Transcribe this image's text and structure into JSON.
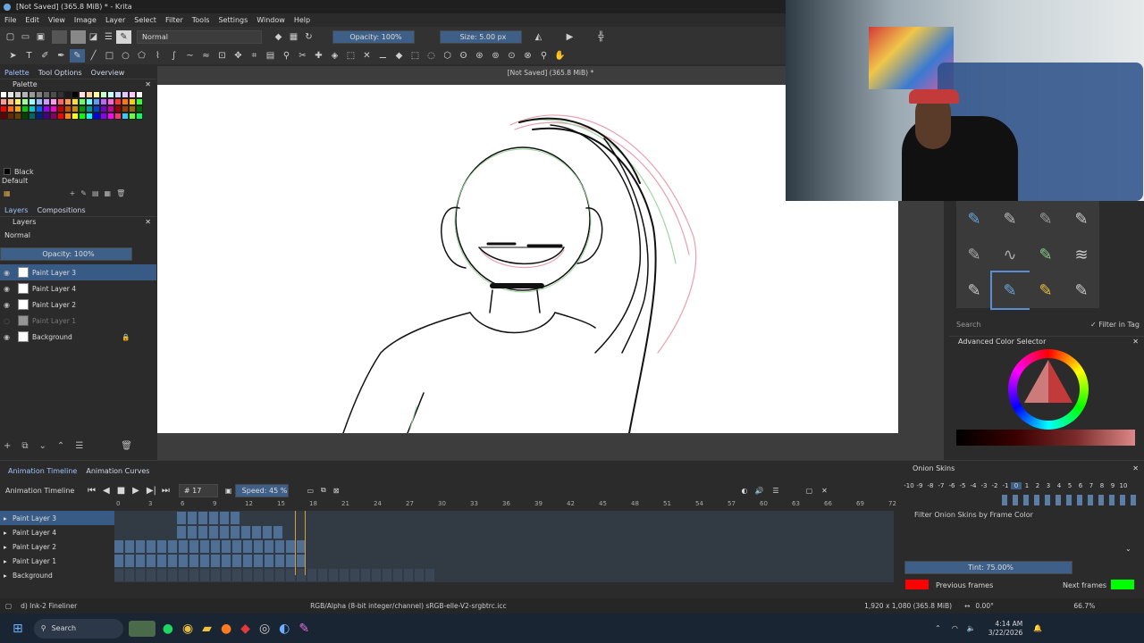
{
  "window": {
    "title": "[Not Saved]  (365.8 MiB) * - Krita"
  },
  "menu": [
    "File",
    "Edit",
    "View",
    "Image",
    "Layer",
    "Select",
    "Filter",
    "Tools",
    "Settings",
    "Window",
    "Help"
  ],
  "toolbar": {
    "blend_mode": "Normal",
    "opacity": "Opacity: 100%",
    "size": "Size: 5.00 px"
  },
  "left_tabs": [
    "Palette",
    "Tool Options",
    "Overview"
  ],
  "palette": {
    "title": "Palette",
    "current_color_name": "Black",
    "palette_name": "Default",
    "colors": [
      "#ffffff",
      "#e6e6e6",
      "#cccccc",
      "#b3b3b3",
      "#999999",
      "#808080",
      "#666666",
      "#4d4d4d",
      "#333333",
      "#1a1a1a",
      "#000000",
      "#ffe0e0",
      "#ffd0a0",
      "#ffff99",
      "#c8ffc8",
      "#c8ffff",
      "#c8d8ff",
      "#e0c8ff",
      "#ffc8ff",
      "#ffffff",
      "#ff9999",
      "#ffbb77",
      "#ffee66",
      "#99ff99",
      "#99ffff",
      "#99bbff",
      "#cc99ff",
      "#ff99ee",
      "#ff6666",
      "#ff9944",
      "#ffdd33",
      "#66ff66",
      "#66ffff",
      "#6699ff",
      "#bb66ff",
      "#ff66dd",
      "#ff3333",
      "#ff7711",
      "#ffcc00",
      "#33ff33",
      "#ff0000",
      "#ff6600",
      "#ffaa00",
      "#00cc00",
      "#00cccc",
      "#0066ff",
      "#9900ff",
      "#ff00cc",
      "#cc0000",
      "#cc5200",
      "#cc8800",
      "#009900",
      "#009999",
      "#0044cc",
      "#7700cc",
      "#cc0099",
      "#990000",
      "#993d00",
      "#996600",
      "#006600",
      "#660000",
      "#662900",
      "#664400",
      "#004400",
      "#006666",
      "#002288",
      "#440088",
      "#880066",
      "#ff0000",
      "#ff8800",
      "#ffff00",
      "#00ff00",
      "#00ffff",
      "#0000ff",
      "#8800ff",
      "#ff00ff",
      "#ff3366",
      "#33ccff",
      "#66ff33",
      "#00ff66"
    ]
  },
  "layers_panel": {
    "tabs": [
      "Layers",
      "Compositions"
    ],
    "title": "Layers",
    "blend_mode": "Normal",
    "opacity": "Opacity:  100%",
    "layers": [
      {
        "name": "Paint Layer 3",
        "selected": true
      },
      {
        "name": "Paint Layer 4",
        "selected": false
      },
      {
        "name": "Paint Layer 2",
        "selected": false
      },
      {
        "name": "Paint Layer 1",
        "selected": false,
        "hidden": true
      },
      {
        "name": "Background",
        "selected": false,
        "locked": true
      }
    ]
  },
  "canvas": {
    "title": "[Not Saved]  (365.8 MiB) *"
  },
  "brushes": {
    "search_placeholder": "Search",
    "filter_label": "Filter in Tag"
  },
  "color_selector": {
    "title": "Advanced Color Selector"
  },
  "timeline": {
    "tabs": [
      "Animation Timeline",
      "Animation Curves"
    ],
    "label": "Animation Timeline",
    "current_frame": "17",
    "speed": "Speed: 45 %",
    "ruler": [
      "0",
      "3",
      "6",
      "9",
      "12",
      "15",
      "18",
      "21",
      "24",
      "27",
      "30",
      "33",
      "36",
      "39",
      "42",
      "45",
      "48",
      "51",
      "54",
      "57",
      "60",
      "63",
      "66",
      "69",
      "72"
    ],
    "layers": [
      "Paint Layer 3",
      "Paint Layer 4",
      "Paint Layer 2",
      "Paint Layer 1",
      "Background"
    ]
  },
  "onion": {
    "title": "Onion Skins",
    "numbers": [
      "-10",
      "-9",
      "-8",
      "-7",
      "-6",
      "-5",
      "-4",
      "-3",
      "-2",
      "-1",
      "0",
      "1",
      "2",
      "3",
      "4",
      "5",
      "6",
      "7",
      "8",
      "9",
      "10"
    ],
    "filter_label": "Filter Onion Skins by Frame Color",
    "tint": "Tint: 75.00%",
    "previous_label": "Previous frames",
    "next_label": "Next frames",
    "previous_color": "#ff0000",
    "next_color": "#00ff00"
  },
  "status": {
    "brush": "d) Ink-2 Fineliner",
    "color_space": "RGB/Alpha (8-bit integer/channel)  sRGB-elle-V2-srgbtrc.icc",
    "dimensions": "1,920 x 1,080 (365.8 MiB)",
    "rotation": "0.00°",
    "zoom": "66.7%"
  },
  "taskbar": {
    "search": "Search",
    "time": "4:14 AM",
    "date": "3/22/2026"
  }
}
